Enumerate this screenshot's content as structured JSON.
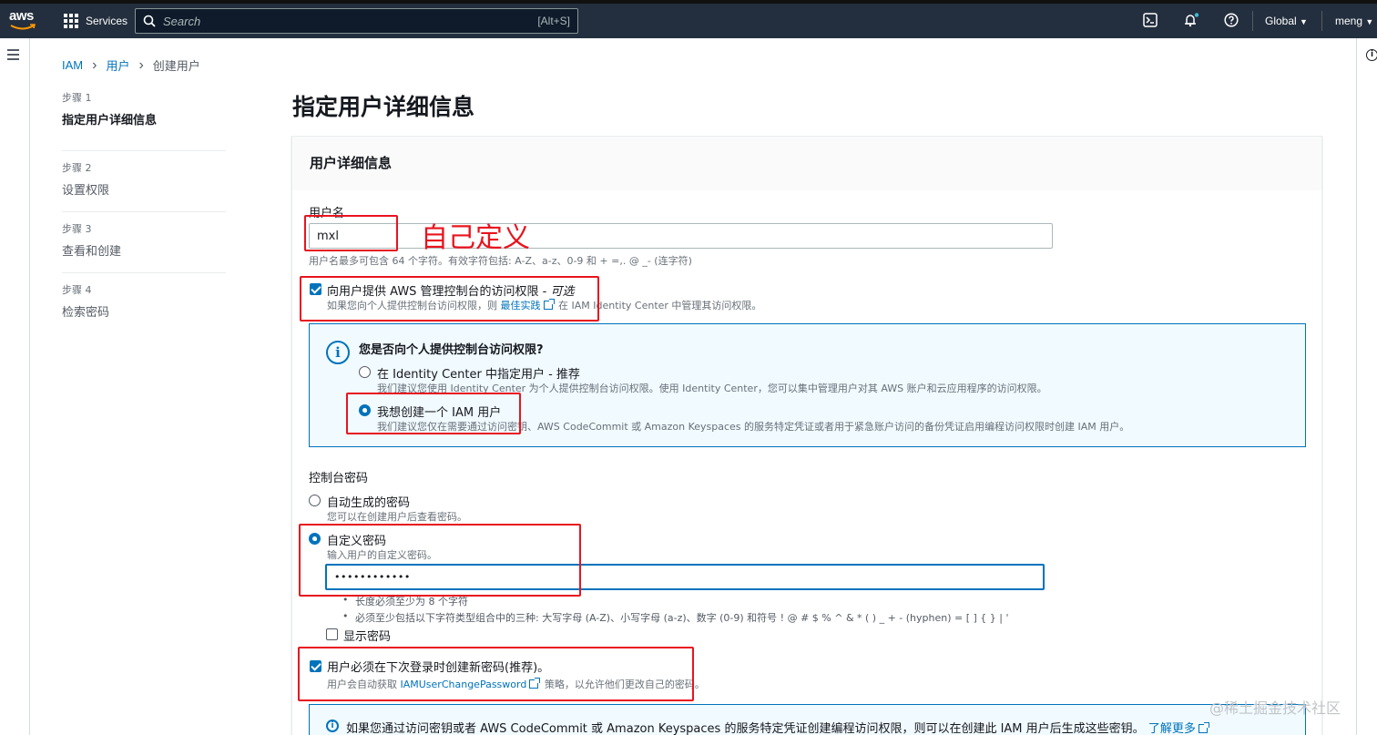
{
  "topbar": {
    "logo": "aws",
    "services": "Services",
    "search_placeholder": "Search",
    "search_shortcut": "[Alt+S]",
    "region": "Global",
    "user": "meng"
  },
  "breadcrumb": {
    "root": "IAM",
    "parent": "用户",
    "current": "创建用户"
  },
  "steps": [
    {
      "num": "步骤 1",
      "label": "指定用户详细信息"
    },
    {
      "num": "步骤 2",
      "label": "设置权限"
    },
    {
      "num": "步骤 3",
      "label": "查看和创建"
    },
    {
      "num": "步骤 4",
      "label": "检索密码"
    }
  ],
  "page_title": "指定用户详细信息",
  "panel": {
    "header": "用户详细信息",
    "username_label": "用户名",
    "username_value": "mxl",
    "username_hint": "用户名最多可包含 64 个字符。有效字符包括: A-Z、a-z、0-9 和 + =,. @ _- (连字符)",
    "console_access_label": "向用户提供 AWS 管理控制台的访问权限 - ",
    "console_access_optional": "可选",
    "console_access_hint_pre": "如果您向个人提供控制台访问权限，则",
    "console_access_hint_link": "最佳实践",
    "console_access_hint_post": "在 IAM Identity Center 中管理其访问权限。",
    "info_title": "您是否向个人提供控制台访问权限?",
    "option_identity_center": "在 Identity Center 中指定用户 - 推荐",
    "option_identity_center_hint": "我们建议您使用 Identity Center 为个人提供控制台访问权限。使用 Identity Center，您可以集中管理用户对其 AWS 账户和云应用程序的访问权限。",
    "option_iam_user": "我想创建一个 IAM 用户",
    "option_iam_user_hint": "我们建议您仅在需要通过访问密钥、AWS CodeCommit 或 Amazon Keyspaces 的服务特定凭证或者用于紧急账户访问的备份凭证启用编程访问权限时创建 IAM 用户。",
    "console_password_label": "控制台密码",
    "auto_password": "自动生成的密码",
    "auto_password_hint": "您可以在创建用户后查看密码。",
    "custom_password": "自定义密码",
    "custom_password_hint": "输入用户的自定义密码。",
    "password_value": "••••••••••••",
    "rule_1": "长度必须至少为 8 个字符",
    "rule_2": "必须至少包括以下字符类型组合中的三种: 大写字母 (A-Z)、小写字母 (a-z)、数字 (0-9) 和符号 ! @ # $ % ^ & * ( ) _ + - (hyphen) = [ ] { } | '",
    "show_password": "显示密码",
    "reset_password": "用户必须在下次登录时创建新密码(推荐)。",
    "reset_password_hint_pre": "用户会自动获取",
    "reset_password_hint_link": "IAMUserChangePassword",
    "reset_password_hint_post": "策略，以允许他们更改自己的密码。",
    "bottom_info": "如果您通过访问密钥或者 AWS CodeCommit 或 Amazon Keyspaces 的服务特定凭证创建编程访问权限，则可以在创建此 IAM 用户后生成这些密钥。",
    "bottom_info_link": "了解更多"
  },
  "annotation": "自己定义",
  "watermark": "@稀土掘金技术社区",
  "colors": {
    "accent": "#0073bb",
    "topbar": "#232f3e",
    "annotation": "#e8141e"
  }
}
